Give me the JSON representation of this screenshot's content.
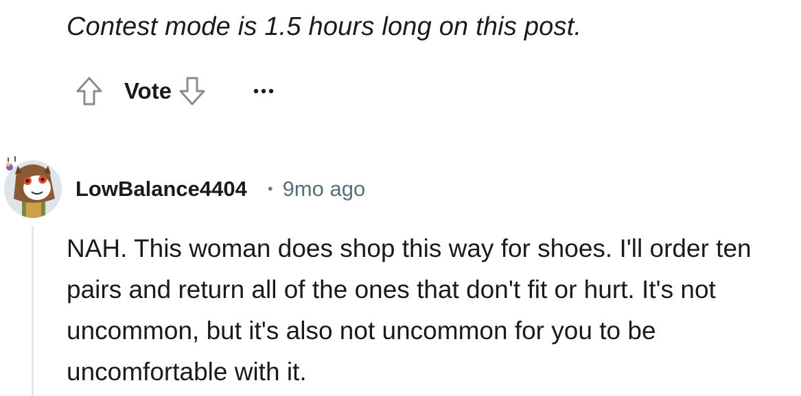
{
  "post": {
    "notice": "Contest mode is 1.5 hours long on this post."
  },
  "actions": {
    "upvote_icon": "arrow-up-outline-icon",
    "vote_label": "Vote",
    "downvote_icon": "arrow-down-outline-icon",
    "more_icon": "ellipsis-icon"
  },
  "comment": {
    "username": "LowBalance4404",
    "separator": "•",
    "timestamp": "9mo ago",
    "body": "NAH. This woman does shop this way for shoes. I'll order ten pairs and return all of the ones that don't fit or hurt. It's not uncommon, but it's also not uncommon for you to be uncomfortable with it."
  },
  "colors": {
    "text": "#1a1a1b",
    "muted": "#576f76",
    "thread_line": "#e3e6e8",
    "icon_stroke": "#8a8a8a"
  }
}
